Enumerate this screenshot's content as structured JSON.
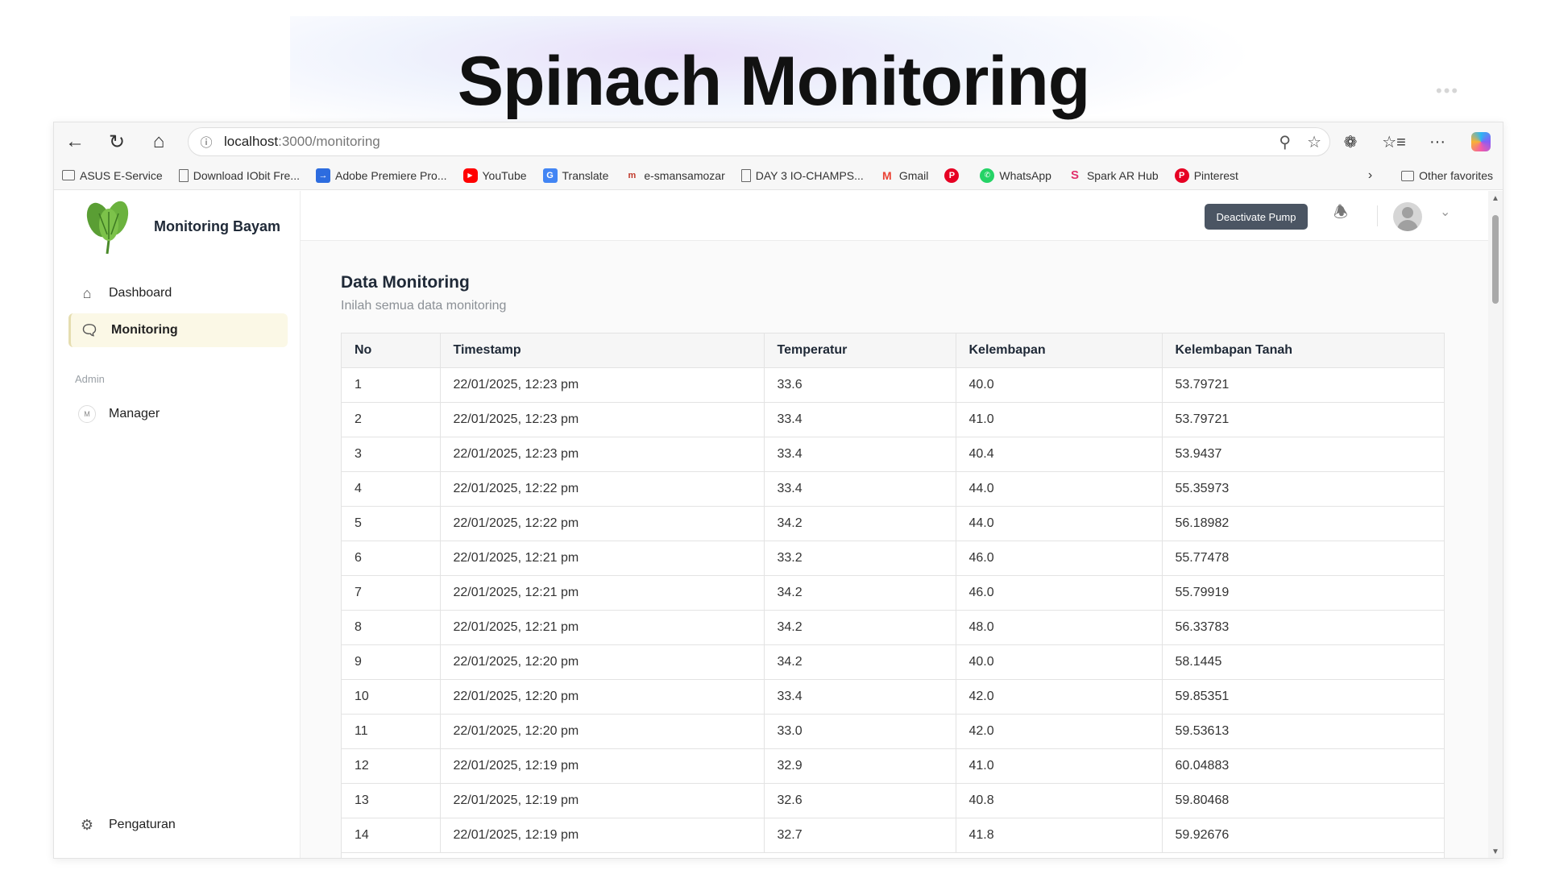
{
  "slide": {
    "title": "Spinach Monitoring"
  },
  "browser": {
    "url_host": "localhost",
    "url_path": ":3000/monitoring",
    "bookmarks": [
      {
        "label": "ASUS E-Service",
        "icon": "folder-icon"
      },
      {
        "label": "Download IObit Fre...",
        "icon": "page-icon"
      },
      {
        "label": "Adobe Premiere Pro...",
        "icon": "premiere-icon"
      },
      {
        "label": "YouTube",
        "icon": "youtube-icon"
      },
      {
        "label": "Translate",
        "icon": "translate-icon"
      },
      {
        "label": "e-smansamozar",
        "icon": "esmansa-icon"
      },
      {
        "label": "DAY 3 IO-CHAMPS...",
        "icon": "page-icon"
      },
      {
        "label": "Gmail",
        "icon": "gmail-icon"
      },
      {
        "label": "",
        "icon": "pinterest-icon"
      },
      {
        "label": "WhatsApp",
        "icon": "whatsapp-icon"
      },
      {
        "label": "Spark AR Hub",
        "icon": "spark-icon"
      },
      {
        "label": "Pinterest",
        "icon": "pinterest-icon"
      }
    ],
    "other_favorites": "Other favorites"
  },
  "sidebar": {
    "brand": "Monitoring Bayam",
    "items": [
      {
        "label": "Dashboard",
        "icon": "home-icon"
      },
      {
        "label": "Monitoring",
        "icon": "chat-icon"
      }
    ],
    "admin_label": "Admin",
    "admin_items": [
      {
        "label": "Manager",
        "badge": "M"
      }
    ],
    "settings_label": "Pengaturan"
  },
  "topbar": {
    "pump_button": "Deactivate Pump"
  },
  "content": {
    "title": "Data Monitoring",
    "subtitle": "Inilah semua data monitoring"
  },
  "table": {
    "columns": [
      "No",
      "Timestamp",
      "Temperatur",
      "Kelembapan",
      "Kelembapan Tanah"
    ],
    "rows": [
      [
        "1",
        "22/01/2025, 12:23 pm",
        "33.6",
        "40.0",
        "53.79721"
      ],
      [
        "2",
        "22/01/2025, 12:23 pm",
        "33.4",
        "41.0",
        "53.79721"
      ],
      [
        "3",
        "22/01/2025, 12:23 pm",
        "33.4",
        "40.4",
        "53.9437"
      ],
      [
        "4",
        "22/01/2025, 12:22 pm",
        "33.4",
        "44.0",
        "55.35973"
      ],
      [
        "5",
        "22/01/2025, 12:22 pm",
        "34.2",
        "44.0",
        "56.18982"
      ],
      [
        "6",
        "22/01/2025, 12:21 pm",
        "33.2",
        "46.0",
        "55.77478"
      ],
      [
        "7",
        "22/01/2025, 12:21 pm",
        "34.2",
        "46.0",
        "55.79919"
      ],
      [
        "8",
        "22/01/2025, 12:21 pm",
        "34.2",
        "48.0",
        "56.33783"
      ],
      [
        "9",
        "22/01/2025, 12:20 pm",
        "34.2",
        "40.0",
        "58.1445"
      ],
      [
        "10",
        "22/01/2025, 12:20 pm",
        "33.4",
        "42.0",
        "59.85351"
      ],
      [
        "11",
        "22/01/2025, 12:20 pm",
        "33.0",
        "42.0",
        "59.53613"
      ],
      [
        "12",
        "22/01/2025, 12:19 pm",
        "32.9",
        "41.0",
        "60.04883"
      ],
      [
        "13",
        "22/01/2025, 12:19 pm",
        "32.6",
        "40.8",
        "59.80468"
      ],
      [
        "14",
        "22/01/2025, 12:19 pm",
        "32.7",
        "41.8",
        "59.92676"
      ]
    ]
  }
}
